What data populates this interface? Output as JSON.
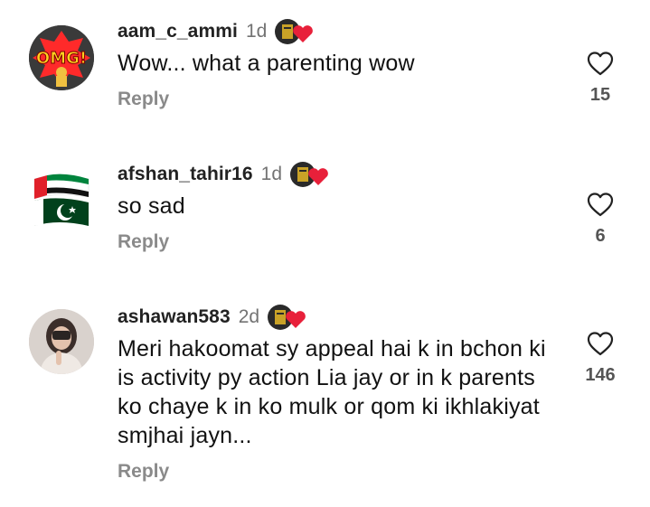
{
  "comments": [
    {
      "username": "aam_c_ammi",
      "time": "1d",
      "text": "Wow... what a parenting wow",
      "reply_label": "Reply",
      "likes": "15",
      "avatar_text": "OMG!"
    },
    {
      "username": "afshan_tahir16",
      "time": "1d",
      "text": "so sad",
      "reply_label": "Reply",
      "likes": "6"
    },
    {
      "username": "ashawan583",
      "time": "2d",
      "text": "Meri hakoomat sy appeal hai k in bchon ki is activity py action Lia jay or in k parents ko chaye k in ko mulk or qom ki ikhlakiyat smjhai jayn...",
      "reply_label": "Reply",
      "likes": "146"
    }
  ],
  "icons": {
    "like": "heart-outline-icon",
    "badge": "fan-badge-icon"
  },
  "colors": {
    "username": "#222222",
    "timestamp": "#737373",
    "reply": "#8a8a8a",
    "like_count": "#555555",
    "badge_heart": "#e8203a"
  }
}
